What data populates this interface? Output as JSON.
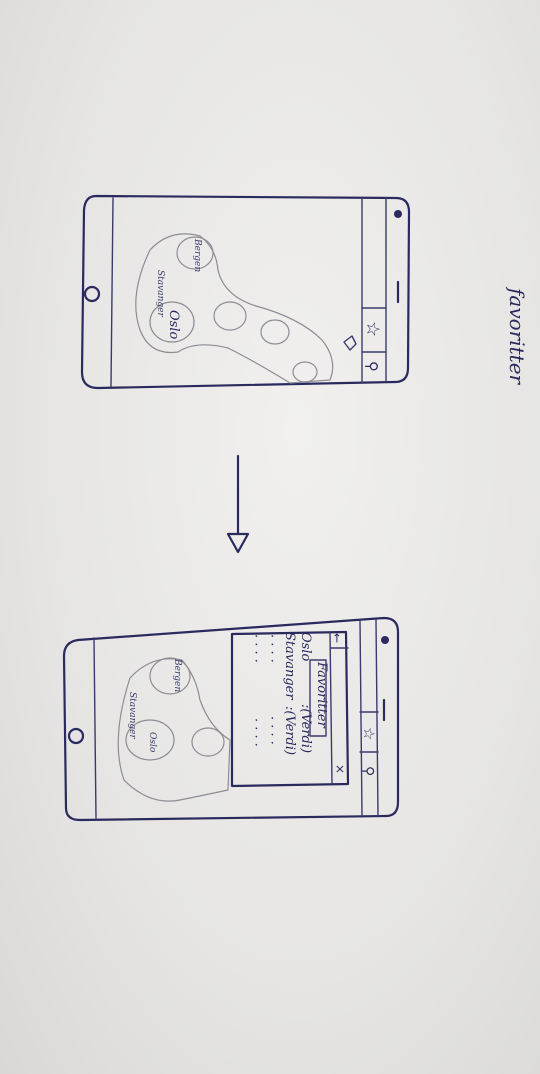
{
  "caption": "favoritter",
  "before": {
    "map_labels": [
      "Oslo",
      "Stavanger",
      "Bergen"
    ],
    "toolbar_icons": [
      "star-icon",
      "search-icon"
    ]
  },
  "after": {
    "panel_title": "Favoritter",
    "back_glyph": "←",
    "close_glyph": "×",
    "rows": [
      {
        "name": "Oslo",
        "value": ":(Verdi)"
      },
      {
        "name": "Stavanger",
        "value": ":(Verdi)"
      },
      {
        "name": "· · · ·",
        "value": "· · · ·"
      },
      {
        "name": "· · · ·",
        "value": "· · · ·"
      }
    ],
    "map_labels": [
      "Oslo",
      "Stavanger",
      "Bergen"
    ],
    "toolbar_icons": [
      "star-icon",
      "search-icon"
    ]
  },
  "icons": {
    "star_glyph": "☆",
    "search_glyph": "⚲",
    "home_glyph": "♡",
    "camera_glyph": "●",
    "arrow": "arrow-down-icon"
  }
}
